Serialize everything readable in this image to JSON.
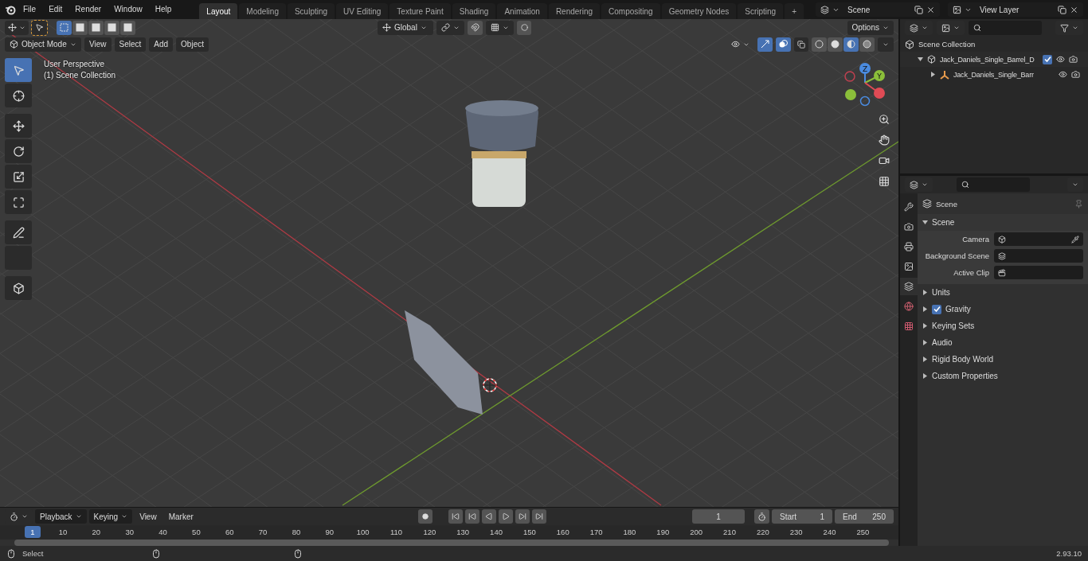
{
  "top_bar": {
    "menus": [
      "File",
      "Edit",
      "Render",
      "Window",
      "Help"
    ],
    "workspaces": [
      {
        "label": "Layout",
        "selected": true
      },
      {
        "label": "Modeling",
        "selected": false
      },
      {
        "label": "Sculpting",
        "selected": false
      },
      {
        "label": "UV Editing",
        "selected": false
      },
      {
        "label": "Texture Paint",
        "selected": false
      },
      {
        "label": "Shading",
        "selected": false
      },
      {
        "label": "Animation",
        "selected": false
      },
      {
        "label": "Rendering",
        "selected": false
      },
      {
        "label": "Compositing",
        "selected": false
      },
      {
        "label": "Geometry Nodes",
        "selected": false
      },
      {
        "label": "Scripting",
        "selected": false
      }
    ],
    "add_tab": "+",
    "scene": "Scene",
    "view_layer": "View Layer"
  },
  "viewport": {
    "select_modes": [
      {
        "selected": true
      },
      {
        "selected": false
      },
      {
        "selected": false
      },
      {
        "selected": false
      },
      {
        "selected": false
      }
    ],
    "orientation": "Global",
    "options": "Options",
    "mode": "Object Mode",
    "menus": [
      "View",
      "Select",
      "Add",
      "Object"
    ],
    "shading_modes": [
      {
        "selected": false
      },
      {
        "selected": false
      },
      {
        "selected": true
      },
      {
        "selected": false
      }
    ],
    "view_name": "User Perspective",
    "collection": "(1) Scene Collection",
    "tools": [
      {
        "selected": true
      },
      {
        "selected": false
      },
      {
        "selected": false
      },
      {
        "selected": false
      },
      {
        "selected": false
      },
      {
        "selected": false
      },
      {
        "selected": false
      },
      {
        "selected": false
      },
      {
        "selected": false
      }
    ],
    "gizmo": {
      "z": "Z",
      "y": "Y"
    }
  },
  "outliner": {
    "root": "Scene Collection",
    "items": [
      {
        "label": "Jack_Daniels_Single_Barrel_D",
        "expanded": true,
        "checked": true,
        "children": [
          {
            "label": "Jack_Daniels_Single_Barr",
            "expanded": false
          }
        ]
      }
    ]
  },
  "properties": {
    "tabs": [
      {
        "selected": false
      },
      {
        "selected": false
      },
      {
        "selected": false
      },
      {
        "selected": false
      },
      {
        "selected": true
      },
      {
        "selected": false
      },
      {
        "selected": false
      }
    ],
    "context": "Scene",
    "panels": [
      {
        "label": "Scene",
        "kind": "plain",
        "expanded": true,
        "fields": [
          {
            "label": "Camera"
          },
          {
            "label": "Background Scene"
          },
          {
            "label": "Active Clip"
          }
        ]
      },
      {
        "label": "Units",
        "kind": "plain",
        "expanded": false
      },
      {
        "label": "Gravity",
        "kind": "checkbox",
        "expanded": false,
        "checked": true
      },
      {
        "label": "Keying Sets",
        "kind": "plain",
        "expanded": false
      },
      {
        "label": "Audio",
        "kind": "plain",
        "expanded": false
      },
      {
        "label": "Rigid Body World",
        "kind": "plain",
        "expanded": false
      },
      {
        "label": "Custom Properties",
        "kind": "plain",
        "expanded": false
      }
    ]
  },
  "timeline": {
    "menus": [
      {
        "label": "Playback",
        "kind": "dropdown"
      },
      {
        "label": "Keying",
        "kind": "dropdown"
      },
      {
        "label": "View",
        "kind": "menu"
      },
      {
        "label": "Marker",
        "kind": "menu"
      }
    ],
    "current_frame": "1",
    "start_label": "Start",
    "start": "1",
    "end_label": "End",
    "end": "250",
    "playhead": "1",
    "ruler": [
      "10",
      "20",
      "30",
      "40",
      "50",
      "60",
      "70",
      "80",
      "90",
      "100",
      "110",
      "120",
      "130",
      "140",
      "150",
      "160",
      "170",
      "180",
      "190",
      "200",
      "210",
      "220",
      "230",
      "240",
      "250"
    ]
  },
  "status_bar": {
    "hint": "Select",
    "version": "2.93.10"
  }
}
